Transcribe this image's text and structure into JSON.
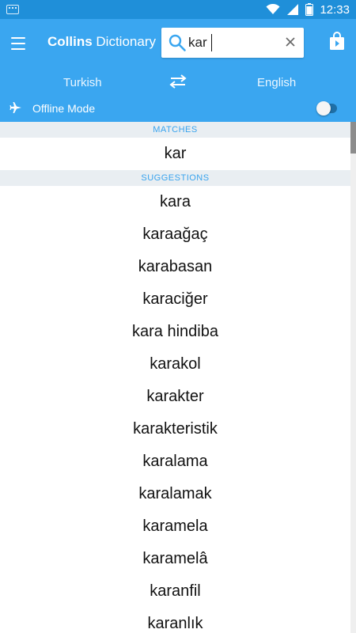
{
  "status_bar": {
    "time": "12:33"
  },
  "app_bar": {
    "title_bold": "Collins",
    "title_rest": "Dictionary",
    "search_value": "kar"
  },
  "languages": {
    "source": "Turkish",
    "target": "English"
  },
  "offline": {
    "label": "Offline Mode",
    "enabled": false
  },
  "colors": {
    "status_bar": "#1f8fd9",
    "app_bar": "#3aa6f0",
    "accent": "#38a3ee",
    "section_bg": "#e9eef2"
  },
  "icons": [
    "keyboard-icon",
    "wifi-icon",
    "signal-icon",
    "battery-icon",
    "menu-icon",
    "search-icon",
    "clear-icon",
    "bag-icon",
    "swap-icon",
    "airplane-icon"
  ],
  "matches": {
    "header": "MATCHES",
    "items": [
      "kar"
    ]
  },
  "suggestions": {
    "header": "SUGGESTIONS",
    "items": [
      "kara",
      "karaağaç",
      "karabasan",
      "karaciğer",
      "kara hindiba",
      "karakol",
      "karakter",
      "karakteristik",
      "karalama",
      "karalamak",
      "karamela",
      "karamelâ",
      "karanfil",
      "karanlık"
    ]
  }
}
